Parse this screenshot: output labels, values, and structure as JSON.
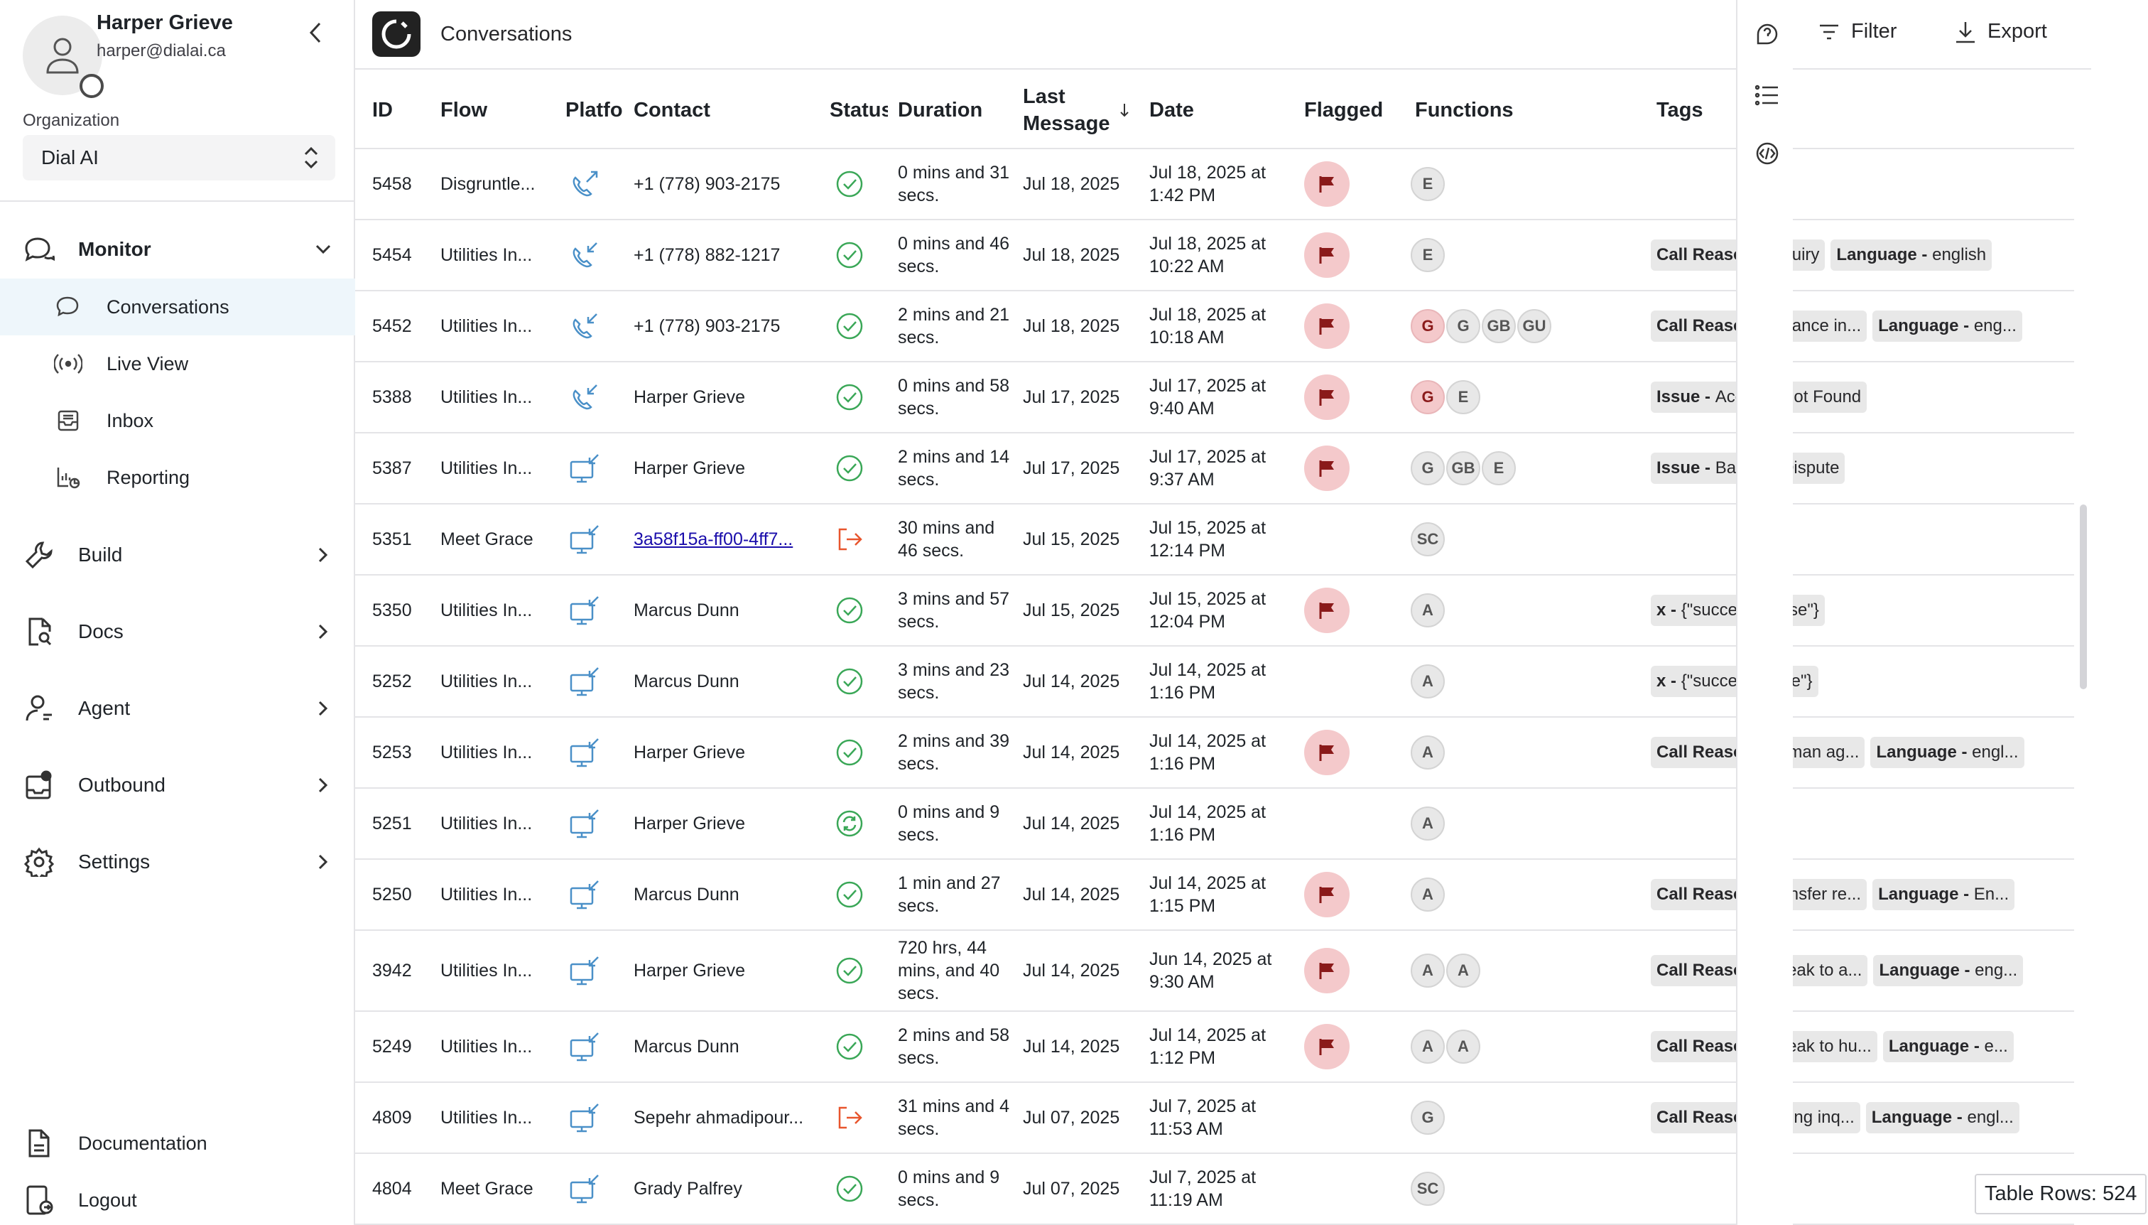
{
  "user": {
    "name": "Harper Grieve",
    "email": "harper@dialai.ca"
  },
  "organization": {
    "label": "Organization",
    "value": "Dial AI"
  },
  "nav": {
    "monitor": "Monitor",
    "sub": [
      "Conversations",
      "Live View",
      "Inbox",
      "Reporting"
    ],
    "build": "Build",
    "docs": "Docs",
    "agent": "Agent",
    "outbound": "Outbound",
    "settings": "Settings",
    "documentation": "Documentation",
    "logout": "Logout"
  },
  "page": {
    "title": "Conversations",
    "filter": "Filter",
    "export": "Export"
  },
  "columns": {
    "id": "ID",
    "flow": "Flow",
    "platform": "Platfo",
    "contact": "Contact",
    "status": "Status",
    "duration": "Duration",
    "last_message": "Last Message",
    "date": "Date",
    "flagged": "Flagged",
    "functions": "Functions",
    "tags": "Tags"
  },
  "rows": [
    {
      "id": "5458",
      "flow": "Disgruntle...",
      "platform": "phone-outgoing",
      "contact": "+1 (778) 903-2175",
      "status": "success",
      "duration": "0 mins and 31 secs.",
      "last": "Jul 18, 2025",
      "date": "Jul 18, 2025 at 1:42 PM",
      "flagged": true,
      "functions": [
        {
          "l": "E"
        }
      ],
      "tags": []
    },
    {
      "id": "5454",
      "flow": "Utilities In...",
      "platform": "phone-incoming",
      "contact": "+1 (778) 882-1217",
      "status": "success",
      "duration": "0 mins and 46 secs.",
      "last": "Jul 18, 2025",
      "date": "Jul 18, 2025 at 10:22 AM",
      "flagged": true,
      "functions": [
        {
          "l": "E"
        }
      ],
      "tags": [
        {
          "k": "Call Reason - ",
          "v": "inquiry"
        },
        {
          "k": "Language - ",
          "v": "english"
        }
      ]
    },
    {
      "id": "5452",
      "flow": "Utilities In...",
      "platform": "phone-incoming",
      "contact": "+1 (778) 903-2175",
      "status": "success",
      "duration": "2 mins and 21 secs.",
      "last": "Jul 18, 2025",
      "date": "Jul 18, 2025 at 10:18 AM",
      "flagged": true,
      "functions": [
        {
          "l": "G",
          "red": true
        },
        {
          "l": "G"
        },
        {
          "l": "GB"
        },
        {
          "l": "GU"
        }
      ],
      "tags": [
        {
          "k": "Call Reason - ",
          "v": "balance in..."
        },
        {
          "k": "Language - ",
          "v": "eng..."
        }
      ]
    },
    {
      "id": "5388",
      "flow": "Utilities In...",
      "platform": "phone-incoming",
      "contact": "Harper Grieve",
      "status": "success",
      "duration": "0 mins and 58 secs.",
      "last": "Jul 17, 2025",
      "date": "Jul 17, 2025 at 9:40 AM",
      "flagged": true,
      "functions": [
        {
          "l": "G",
          "red": true
        },
        {
          "l": "E"
        }
      ],
      "tags": [
        {
          "k": "Issue - ",
          "v": "Account Not Found"
        }
      ]
    },
    {
      "id": "5387",
      "flow": "Utilities In...",
      "platform": "web-incoming",
      "contact": "Harper Grieve",
      "status": "success",
      "duration": "2 mins and 14 secs.",
      "last": "Jul 17, 2025",
      "date": "Jul 17, 2025 at 9:37 AM",
      "flagged": true,
      "functions": [
        {
          "l": "G"
        },
        {
          "l": "GB"
        },
        {
          "l": "E"
        }
      ],
      "tags": [
        {
          "k": "Issue - ",
          "v": "Balance Dispute"
        }
      ]
    },
    {
      "id": "5351",
      "flow": "Meet Grace",
      "platform": "web-incoming",
      "contact": "3a58f15a-ff00-4ff7...",
      "link": true,
      "status": "exit",
      "duration": "30 mins and 46 secs.",
      "last": "Jul 15, 2025",
      "date": "Jul 15, 2025 at 12:14 PM",
      "flagged": false,
      "functions": [
        {
          "l": "SC"
        }
      ],
      "tags": []
    },
    {
      "id": "5350",
      "flow": "Utilities In...",
      "platform": "web-incoming",
      "contact": "Marcus Dunn",
      "status": "success",
      "duration": "3 mins and 57 secs.",
      "last": "Jul 15, 2025",
      "date": "Jul 15, 2025 at 12:04 PM",
      "flagged": true,
      "functions": [
        {
          "l": "A"
        }
      ],
      "tags": [
        {
          "k": "x - ",
          "v": "{\"success\":\"false\"}"
        }
      ]
    },
    {
      "id": "5252",
      "flow": "Utilities In...",
      "platform": "web-incoming",
      "contact": "Marcus Dunn",
      "status": "success",
      "duration": "3 mins and 23 secs.",
      "last": "Jul 14, 2025",
      "date": "Jul 14, 2025 at 1:16 PM",
      "flagged": false,
      "functions": [
        {
          "l": "A"
        }
      ],
      "tags": [
        {
          "k": "x - ",
          "v": "{\"success\":\"true\"}"
        }
      ]
    },
    {
      "id": "5253",
      "flow": "Utilities In...",
      "platform": "web-incoming",
      "contact": "Harper Grieve",
      "status": "success",
      "duration": "2 mins and 39 secs.",
      "last": "Jul 14, 2025",
      "date": "Jul 14, 2025 at 1:16 PM",
      "flagged": true,
      "functions": [
        {
          "l": "A"
        }
      ],
      "tags": [
        {
          "k": "Call Reason - ",
          "v": "human ag..."
        },
        {
          "k": "Language - ",
          "v": "engl..."
        }
      ]
    },
    {
      "id": "5251",
      "flow": "Utilities In...",
      "platform": "web-incoming",
      "contact": "Harper Grieve",
      "status": "in-progress",
      "duration": "0 mins and 9 secs.",
      "last": "Jul 14, 2025",
      "date": "Jul 14, 2025 at 1:16 PM",
      "flagged": false,
      "functions": [
        {
          "l": "A"
        }
      ],
      "tags": []
    },
    {
      "id": "5250",
      "flow": "Utilities In...",
      "platform": "web-incoming",
      "contact": "Marcus Dunn",
      "status": "success",
      "duration": "1 min and 27 secs.",
      "last": "Jul 14, 2025",
      "date": "Jul 14, 2025 at 1:15 PM",
      "flagged": true,
      "functions": [
        {
          "l": "A"
        }
      ],
      "tags": [
        {
          "k": "Call Reason - ",
          "v": "transfer re..."
        },
        {
          "k": "Language - ",
          "v": "En..."
        }
      ]
    },
    {
      "id": "3942",
      "flow": "Utilities In...",
      "platform": "web-incoming",
      "contact": "Harper Grieve",
      "status": "success",
      "duration": "720 hrs, 44 mins, and 40 secs.",
      "last": "Jul 14, 2025",
      "date": "Jun 14, 2025 at 9:30 AM",
      "flagged": true,
      "functions": [
        {
          "l": "A"
        },
        {
          "l": "A"
        }
      ],
      "tags": [
        {
          "k": "Call Reason - ",
          "v": "speak to a..."
        },
        {
          "k": "Language - ",
          "v": "eng..."
        }
      ]
    },
    {
      "id": "5249",
      "flow": "Utilities In...",
      "platform": "web-incoming",
      "contact": "Marcus Dunn",
      "status": "success",
      "duration": "2 mins and 58 secs.",
      "last": "Jul 14, 2025",
      "date": "Jul 14, 2025 at 1:12 PM",
      "flagged": true,
      "functions": [
        {
          "l": "A"
        },
        {
          "l": "A"
        }
      ],
      "tags": [
        {
          "k": "Call Reason - ",
          "v": "speak to hu..."
        },
        {
          "k": "Language - ",
          "v": "e..."
        }
      ]
    },
    {
      "id": "4809",
      "flow": "Utilities In...",
      "platform": "web-incoming",
      "contact": "Sepehr ahmadipour...",
      "status": "exit",
      "duration": "31 mins and 4 secs.",
      "last": "Jul 07, 2025",
      "date": "Jul 7, 2025 at 11:53 AM",
      "flagged": false,
      "functions": [
        {
          "l": "G"
        }
      ],
      "tags": [
        {
          "k": "Call Reason - ",
          "v": "billing inq..."
        },
        {
          "k": "Language - ",
          "v": "engl..."
        }
      ]
    },
    {
      "id": "4804",
      "flow": "Meet Grace",
      "platform": "web-incoming",
      "contact": "Grady Palfrey",
      "status": "success",
      "duration": "0 mins and 9 secs.",
      "last": "Jul 07, 2025",
      "date": "Jul 7, 2025 at 11:19 AM",
      "flagged": false,
      "functions": [
        {
          "l": "SC"
        }
      ],
      "tags": []
    }
  ],
  "table_rows_label": "Table Rows: 524",
  "colors": {
    "accent_bg": "#eef6fb",
    "success": "#3aa757",
    "exit": "#e8552d",
    "flag_bg": "#f4c9cb",
    "flag": "#8a1a1a",
    "link": "#1a0dab"
  }
}
